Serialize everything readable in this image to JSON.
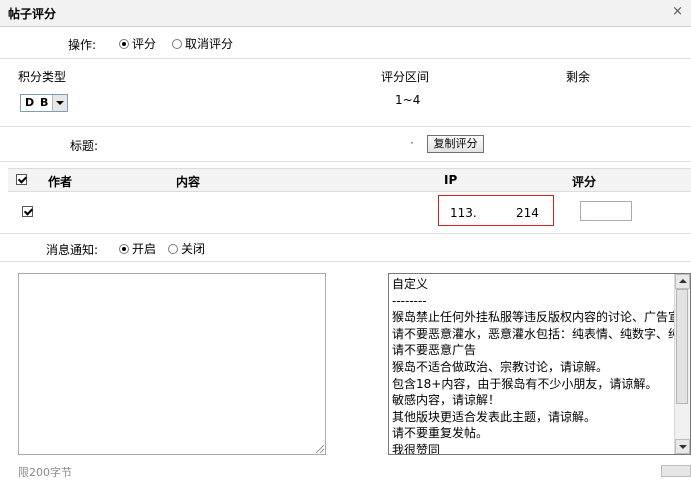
{
  "dialog": {
    "title": "帖子评分",
    "close_label": "×"
  },
  "operation": {
    "label": "操作:",
    "options": [
      {
        "label": "评分",
        "selected": true
      },
      {
        "label": "取消评分",
        "selected": false
      }
    ]
  },
  "score_section": {
    "type_label": "积分类型",
    "range_label": "评分区间",
    "remaining_label": "剩余",
    "type_selected": "D B",
    "range_value": "1~4",
    "remaining_value": ""
  },
  "title_row": {
    "label": "标题:",
    "value": "·",
    "copy_button": "复制评分"
  },
  "table": {
    "headers": {
      "author": "作者",
      "content": "内容",
      "ip": "IP",
      "score": "评分"
    },
    "header_checked": true,
    "row": {
      "checked": true,
      "author": "",
      "content": "",
      "ip_part1": "113.",
      "ip_part2": "214",
      "score_value": ""
    }
  },
  "notify": {
    "label": "消息通知:",
    "options": [
      {
        "label": "开启",
        "selected": true
      },
      {
        "label": "关闭",
        "selected": false
      }
    ]
  },
  "reasons": [
    "自定义",
    "--------",
    "猴岛禁止任何外挂私服等违反版权内容的讨论、广告宣",
    "请不要恶意灌水，恶意灌水包括：纯表情、纯数字、纯",
    "请不要恶意广告",
    "猴岛不适合做政治、宗教讨论，请谅解。",
    "包含18+内容，由于猴岛有不少小朋友，请谅解。",
    "敏感内容，请谅解！",
    "其他版块更适合发表此主题，请谅解。",
    "请不要重复发帖。",
    "我很赞同"
  ],
  "footer": {
    "limit_text": "限200字节"
  },
  "colors": {
    "ip_highlight": "#d61f1f",
    "title_bar": "#f2f2f2"
  }
}
